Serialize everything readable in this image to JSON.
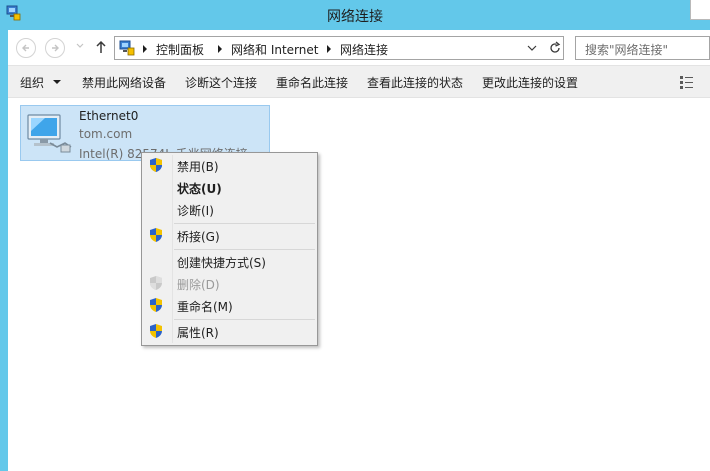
{
  "window": {
    "title": "网络连接"
  },
  "address": {
    "crumbs": [
      "控制面板",
      "网络和 Internet",
      "网络连接"
    ]
  },
  "search": {
    "placeholder": "搜索\"网络连接\""
  },
  "toolbar": {
    "organize": "组织",
    "disable": "禁用此网络设备",
    "diagnose": "诊断这个连接",
    "rename": "重命名此连接",
    "status": "查看此连接的状态",
    "settings": "更改此连接的设置"
  },
  "connection": {
    "name": "Ethernet0",
    "network": "tom.com",
    "device": "Intel(R) 82574L 千兆网络连接"
  },
  "context_menu": {
    "items": [
      {
        "label": "禁用(B)",
        "shield": true,
        "bold": false,
        "disabled": false
      },
      {
        "label": "状态(U)",
        "shield": false,
        "bold": true,
        "disabled": false
      },
      {
        "label": "诊断(I)",
        "shield": false,
        "bold": false,
        "disabled": false
      },
      {
        "label": "桥接(G)",
        "shield": true,
        "bold": false,
        "disabled": false
      },
      {
        "label": "创建快捷方式(S)",
        "shield": false,
        "bold": false,
        "disabled": false
      },
      {
        "label": "删除(D)",
        "shield": true,
        "bold": false,
        "disabled": true
      },
      {
        "label": "重命名(M)",
        "shield": true,
        "bold": false,
        "disabled": false
      },
      {
        "label": "属性(R)",
        "shield": true,
        "bold": false,
        "disabled": false
      }
    ]
  },
  "colors": {
    "titlebar": "#63c8ea",
    "selection": "#cce4f7",
    "toolbar_bg": "#f0f0f0"
  }
}
